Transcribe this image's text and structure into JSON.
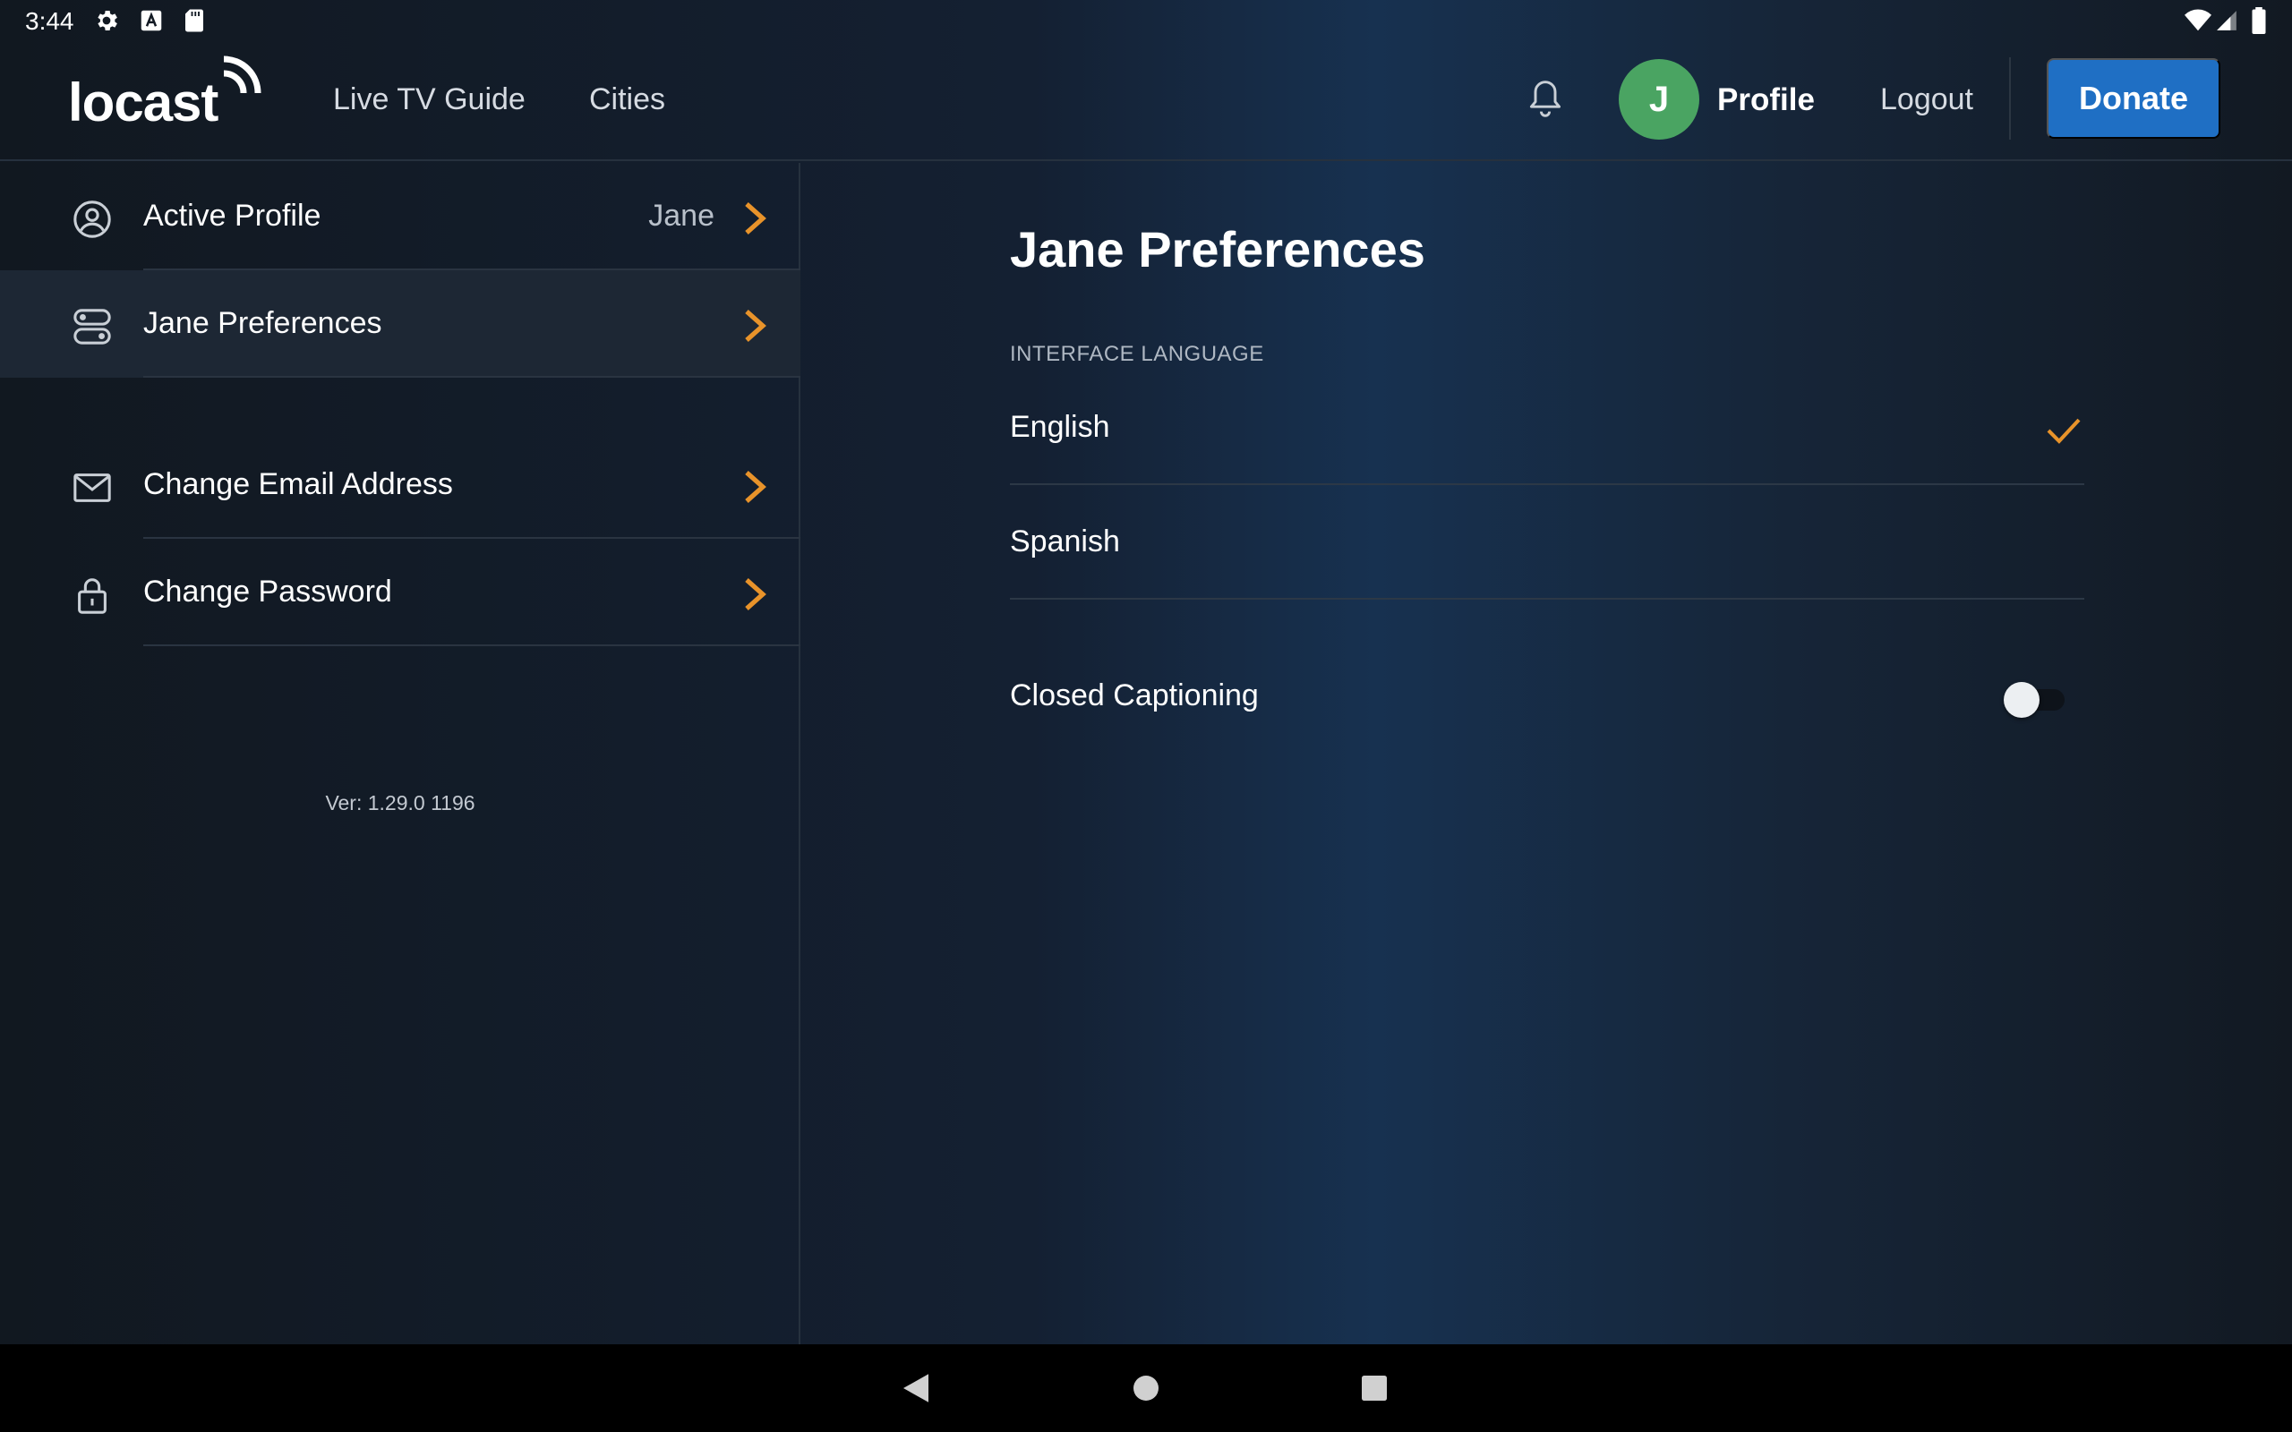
{
  "status_bar": {
    "time": "3:44",
    "left_icons": [
      "gear-icon",
      "font-a-icon",
      "sd-card-icon"
    ],
    "right_icons": [
      "wifi-icon",
      "cell-signal-icon",
      "battery-icon"
    ]
  },
  "header": {
    "logo_text": "locast",
    "nav": [
      {
        "label": "Live TV Guide"
      },
      {
        "label": "Cities"
      }
    ],
    "notification_icon": "bell-icon",
    "avatar_initial": "J",
    "profile_label": "Profile",
    "logout_label": "Logout",
    "donate_label": "Donate"
  },
  "sidebar": {
    "items": [
      {
        "label": "Active Profile",
        "value": "Jane",
        "icon": "user-circle-icon"
      },
      {
        "label": "Jane Preferences",
        "value": "",
        "icon": "toggles-icon",
        "active": true
      },
      {
        "label": "Change Email Address",
        "value": "",
        "icon": "envelope-icon"
      },
      {
        "label": "Change Password",
        "value": "",
        "icon": "lock-icon"
      }
    ],
    "version": "Ver: 1.29.0 1196"
  },
  "main": {
    "title": "Jane Preferences",
    "section_label": "INTERFACE LANGUAGE",
    "languages": [
      {
        "label": "English",
        "selected": true
      },
      {
        "label": "Spanish",
        "selected": false
      }
    ],
    "closed_captioning": {
      "label": "Closed Captioning",
      "enabled": false
    }
  },
  "colors": {
    "accent": "#e8932a",
    "donate": "#1f6fc4",
    "avatar": "#4aa462"
  },
  "nav_bar": {
    "buttons": [
      "back-triangle-icon",
      "home-circle-icon",
      "recents-square-icon"
    ]
  }
}
